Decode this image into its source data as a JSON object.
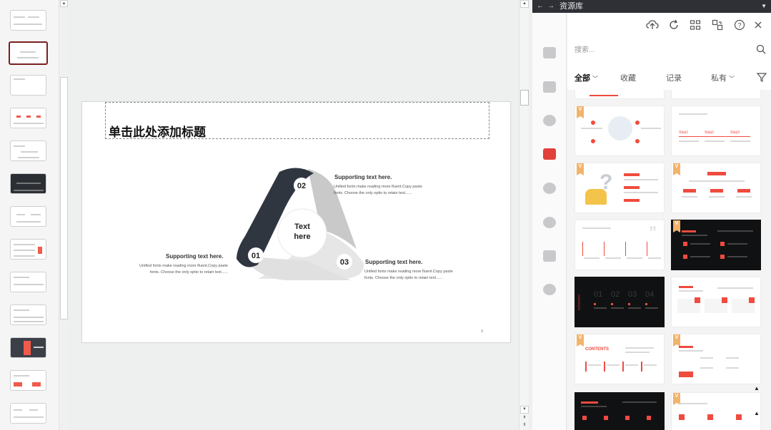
{
  "slide": {
    "title_placeholder": "单击此处添加标题",
    "center_text_line1": "Text",
    "center_text_line2": "here",
    "page_number": "8",
    "points": [
      {
        "num": "02",
        "heading": "Supporting text here.",
        "line1": "Unified fonts make reading more fluent.Copy paste",
        "line2": "fonts. Choose the only optio to retain text......"
      },
      {
        "num": "01",
        "heading": "Supporting text here.",
        "line1": "Unified fonts make reading more fluent.Copy paste",
        "line2": "fonts. Choose the only optio to retain text......"
      },
      {
        "num": "03",
        "heading": "Supporting text here.",
        "line1": "Unified fonts make reading more fluent.Copy paste",
        "line2": "fonts. Choose the only optio to retain text......"
      }
    ]
  },
  "resource_panel": {
    "title": "资源库",
    "search_placeholder": "搜索...",
    "tabs": [
      {
        "label": "全部",
        "has_dropdown": true,
        "active": true
      },
      {
        "label": "收藏",
        "has_dropdown": false,
        "active": false
      },
      {
        "label": "记录",
        "has_dropdown": false,
        "active": false
      },
      {
        "label": "私有",
        "has_dropdown": true,
        "active": false
      }
    ],
    "card_badge": "V",
    "card_texts": {
      "dark_contents": "CONTENTS",
      "card_contents": "CONTENTS",
      "dark_numbers": [
        "01",
        "02",
        "03",
        "04"
      ],
      "step_labels": [
        "Step1",
        "Step2",
        "Step3"
      ]
    }
  },
  "colors": {
    "accent": "#e2403a",
    "dark_navy": "#2f3640",
    "badge": "#f2b36b"
  }
}
